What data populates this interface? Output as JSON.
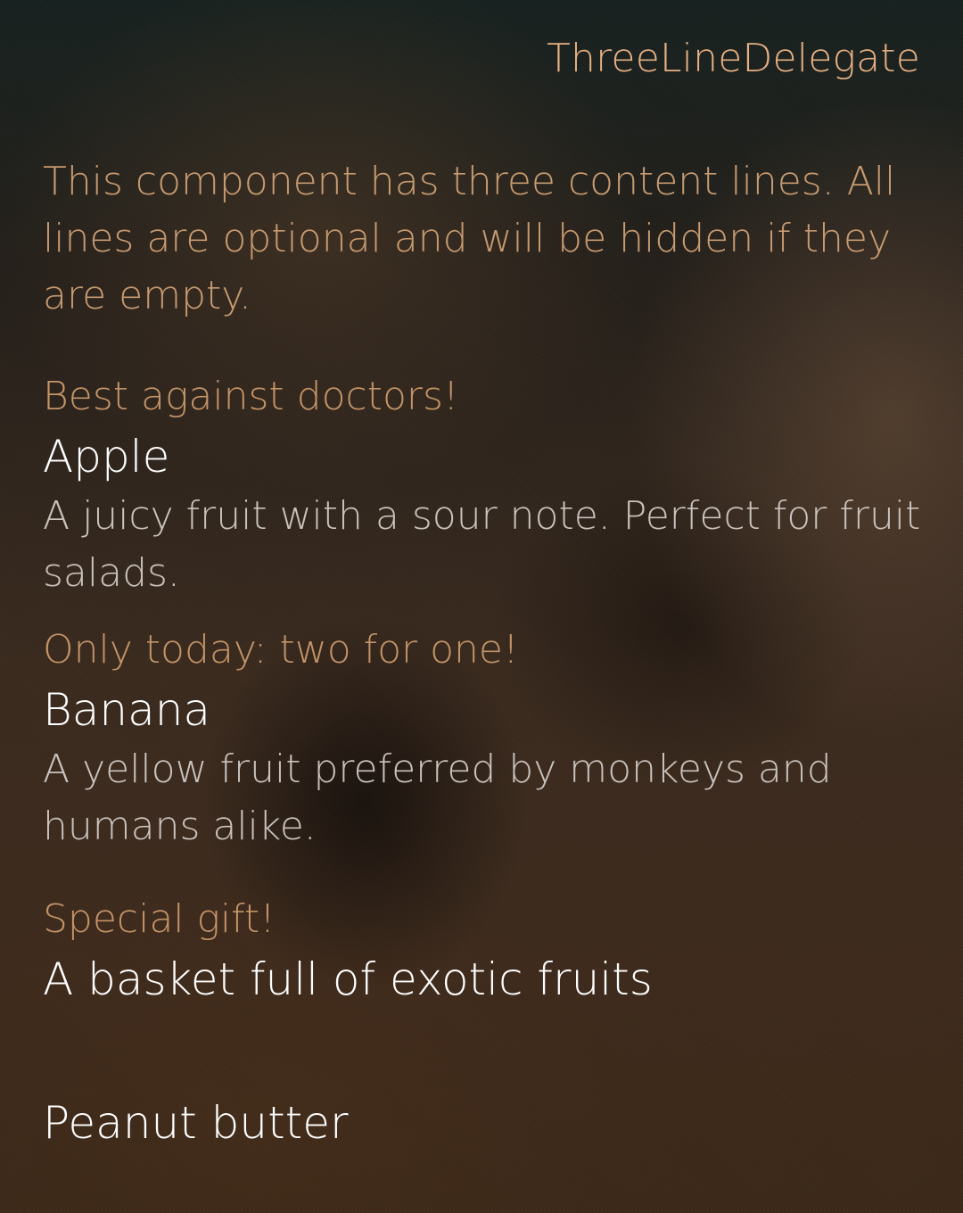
{
  "header": {
    "title": "ThreeLineDelegate"
  },
  "intro": {
    "text": "This component has three content lines. All lines are optional and will be hidden if they are empty."
  },
  "items": [
    {
      "label": "Best against doctors!",
      "text": "Apple",
      "description": "A juicy fruit with a sour note. Perfect for fruit salads."
    },
    {
      "label": "Only today: two for one!",
      "text": "Banana",
      "description": "A yellow fruit preferred by monkeys and humans alike."
    },
    {
      "label": "Special gift!",
      "text": "A basket full of exotic fruits",
      "description": ""
    },
    {
      "label": "",
      "text": "Peanut butter",
      "description": ""
    }
  ],
  "colors": {
    "header": "#e6b083",
    "label": "#c49468",
    "primary_text": "#ffffff",
    "secondary_text": "#c9c2bd"
  }
}
